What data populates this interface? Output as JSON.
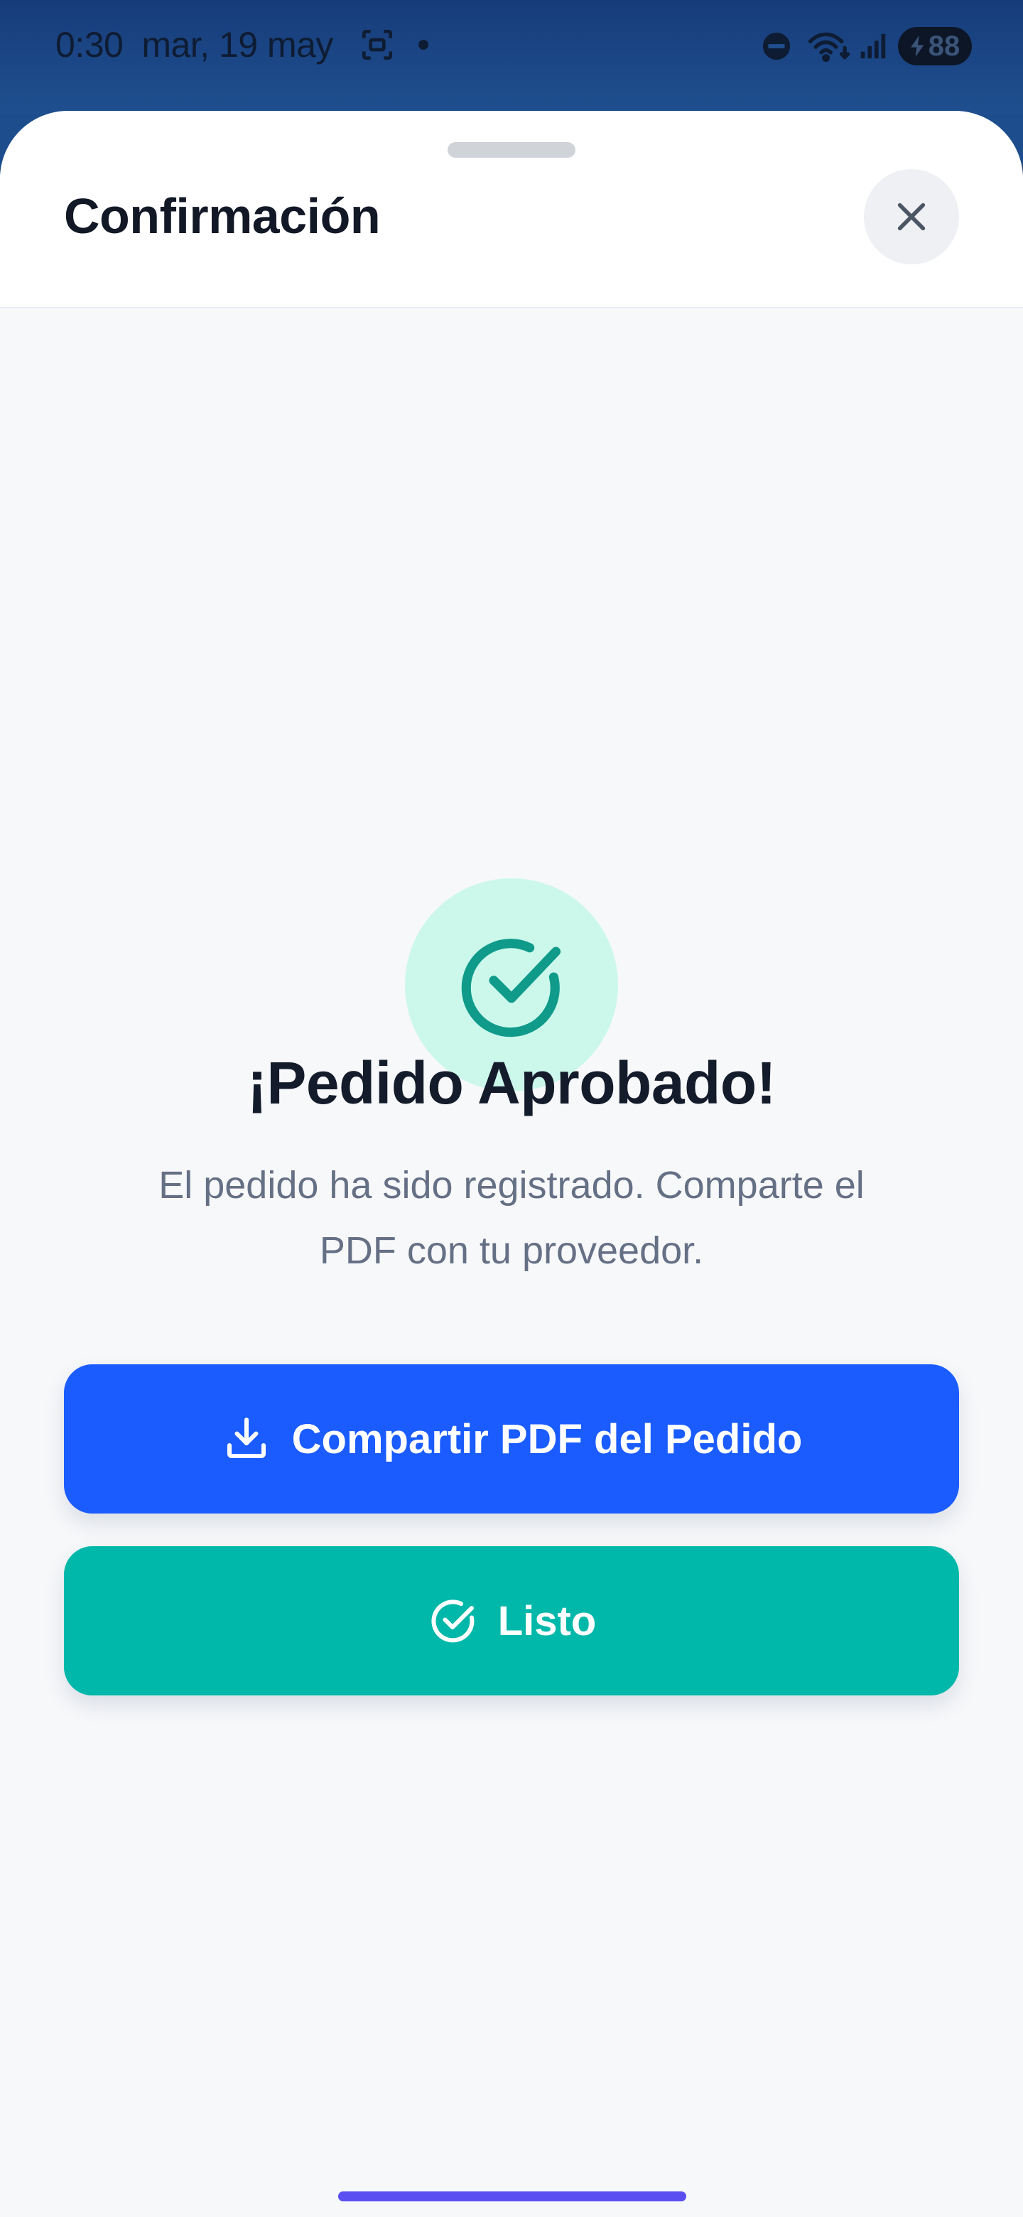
{
  "status_bar": {
    "time": "0:30",
    "date": "mar, 19 may",
    "battery": "88"
  },
  "sheet": {
    "title": "Confirmación"
  },
  "success": {
    "title": "¡Pedido Aprobado!",
    "message": "El pedido ha sido registrado. Comparte el PDF con tu proveedor."
  },
  "buttons": {
    "share_label": "Compartir PDF del Pedido",
    "done_label": "Listo"
  },
  "colors": {
    "primary_blue": "#1a5cff",
    "teal": "#00b8a9",
    "success_bg": "#ccf8ec",
    "success_icon": "#0f9a8a"
  },
  "icons": {
    "close": "close-icon",
    "success": "check-circle-icon",
    "share": "download-icon",
    "done": "check-circle-icon"
  }
}
